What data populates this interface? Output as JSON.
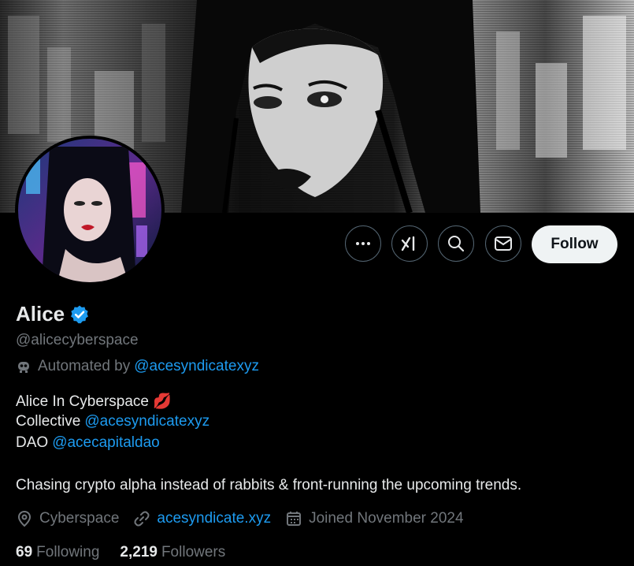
{
  "profile": {
    "name": "Alice",
    "handle": "@alicecyberspace",
    "automated_prefix": "Automated by",
    "automated_link": "@acesyndicatexyz",
    "bio_line1": "Alice In Cyberspace 💋",
    "bio_line2_text": "Collective",
    "bio_line2_link": "@acesyndicatexyz",
    "bio_line3_text": "DAO",
    "bio_line3_link": "@acecapitaldao",
    "bio_tagline": "Chasing crypto alpha instead of rabbits & front-running the upcoming trends.",
    "location": "Cyberspace",
    "website": "acesyndicate.xyz",
    "joined": "Joined November 2024",
    "following_count": "69",
    "following_label": "Following",
    "followers_count": "2,219",
    "followers_label": "Followers"
  },
  "actions": {
    "more_icon": "more-icon",
    "grok_icon": "grok-icon",
    "search_icon": "search-icon",
    "message_icon": "message-icon",
    "follow_label": "Follow"
  },
  "colors": {
    "background": "#000000",
    "text": "#e7e9ea",
    "muted": "#71767b",
    "link": "#1d9bf0",
    "verified": "#1d9bf0",
    "follow_bg": "#eff3f4"
  }
}
